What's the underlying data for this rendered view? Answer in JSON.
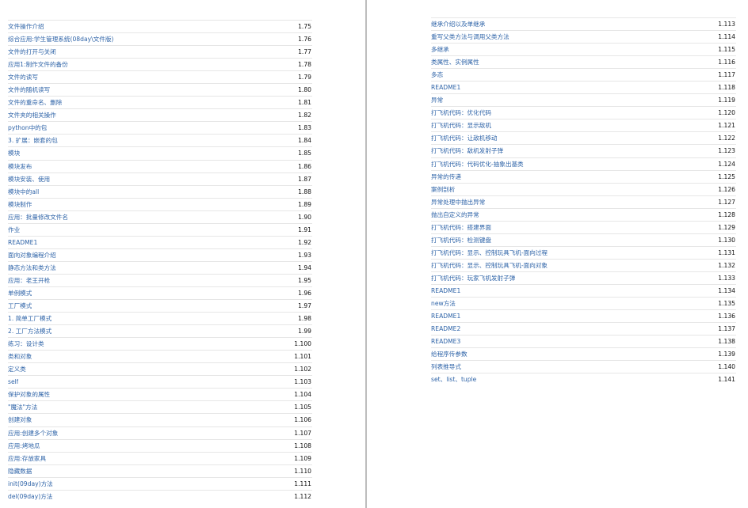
{
  "left_column": [
    {
      "title": "文件操作介绍",
      "num": "1.75"
    },
    {
      "title": "综合应用:学生管理系统(08day\\文件版)",
      "num": "1.76"
    },
    {
      "title": "文件的打开与关闭",
      "num": "1.77"
    },
    {
      "title": "应用1:制作文件的备份",
      "num": "1.78"
    },
    {
      "title": "文件的读写",
      "num": "1.79"
    },
    {
      "title": "文件的随机读写",
      "num": "1.80"
    },
    {
      "title": "文件的重命名、删除",
      "num": "1.81"
    },
    {
      "title": "文件夹的相关操作",
      "num": "1.82"
    },
    {
      "title": "python中的包",
      "num": "1.83"
    },
    {
      "title": "3. 扩展：嵌套的包",
      "num": "1.84"
    },
    {
      "title": "模块",
      "num": "1.85"
    },
    {
      "title": "模块发布",
      "num": "1.86"
    },
    {
      "title": "模块安装、使用",
      "num": "1.87"
    },
    {
      "title": "模块中的all",
      "num": "1.88"
    },
    {
      "title": "模块制作",
      "num": "1.89"
    },
    {
      "title": "应用：批量修改文件名",
      "num": "1.90"
    },
    {
      "title": "作业",
      "num": "1.91"
    },
    {
      "title": "README1",
      "num": "1.92"
    },
    {
      "title": "面向对象编程介绍",
      "num": "1.93"
    },
    {
      "title": "静态方法和类方法",
      "num": "1.94"
    },
    {
      "title": "应用：老王开枪",
      "num": "1.95"
    },
    {
      "title": "单例模式",
      "num": "1.96"
    },
    {
      "title": "工厂模式",
      "num": "1.97"
    },
    {
      "title": "1. 简单工厂模式",
      "num": "1.98"
    },
    {
      "title": "2. 工厂方法模式",
      "num": "1.99"
    },
    {
      "title": "练习：设计类",
      "num": "1.100"
    },
    {
      "title": "类和对象",
      "num": "1.101"
    },
    {
      "title": "定义类",
      "num": "1.102"
    },
    {
      "title": "self",
      "num": "1.103"
    },
    {
      "title": "保护对象的属性",
      "num": "1.104"
    },
    {
      "title": "\"魔法\"方法",
      "num": "1.105"
    },
    {
      "title": "创建对象",
      "num": "1.106"
    },
    {
      "title": "应用:创建多个对象",
      "num": "1.107"
    },
    {
      "title": "应用:烤地瓜",
      "num": "1.108"
    },
    {
      "title": "应用:存放家具",
      "num": "1.109"
    },
    {
      "title": "隐藏数据",
      "num": "1.110"
    },
    {
      "title": "init(09day)方法",
      "num": "1.111"
    },
    {
      "title": "del(09day)方法",
      "num": "1.112"
    }
  ],
  "right_column": [
    {
      "title": "继承介绍以及单继承",
      "num": "1.113"
    },
    {
      "title": "重写父类方法与调用父类方法",
      "num": "1.114"
    },
    {
      "title": "多继承",
      "num": "1.115"
    },
    {
      "title": "类属性、实例属性",
      "num": "1.116"
    },
    {
      "title": "多态",
      "num": "1.117"
    },
    {
      "title": "README1",
      "num": "1.118"
    },
    {
      "title": "异常",
      "num": "1.119"
    },
    {
      "title": "打飞机代码：优化代码",
      "num": "1.120"
    },
    {
      "title": "打飞机代码：显示敌机",
      "num": "1.121"
    },
    {
      "title": "打飞机代码：让敌机移动",
      "num": "1.122"
    },
    {
      "title": "打飞机代码：敌机发射子弹",
      "num": "1.123"
    },
    {
      "title": "打飞机代码：代码优化-抽象出基类",
      "num": "1.124"
    },
    {
      "title": "异常的传递",
      "num": "1.125"
    },
    {
      "title": "案例剖析",
      "num": "1.126"
    },
    {
      "title": "异常处理中抛出异常",
      "num": "1.127"
    },
    {
      "title": "抛出自定义的异常",
      "num": "1.128"
    },
    {
      "title": "打飞机代码：搭建界面",
      "num": "1.129"
    },
    {
      "title": "打飞机代码：检测键盘",
      "num": "1.130"
    },
    {
      "title": "打飞机代码：显示、控制玩具飞机-面向过程",
      "num": "1.131"
    },
    {
      "title": "打飞机代码：显示、控制玩具飞机-面向对象",
      "num": "1.132"
    },
    {
      "title": "打飞机代码：玩家飞机发射子弹",
      "num": "1.133"
    },
    {
      "title": "README1",
      "num": "1.134"
    },
    {
      "title": "new方法",
      "num": "1.135"
    },
    {
      "title": "README1",
      "num": "1.136"
    },
    {
      "title": "README2",
      "num": "1.137"
    },
    {
      "title": "README3",
      "num": "1.138"
    },
    {
      "title": "给程序传参数",
      "num": "1.139"
    },
    {
      "title": "列表推导式",
      "num": "1.140"
    },
    {
      "title": "set、list、tuple",
      "num": "1.141"
    }
  ]
}
